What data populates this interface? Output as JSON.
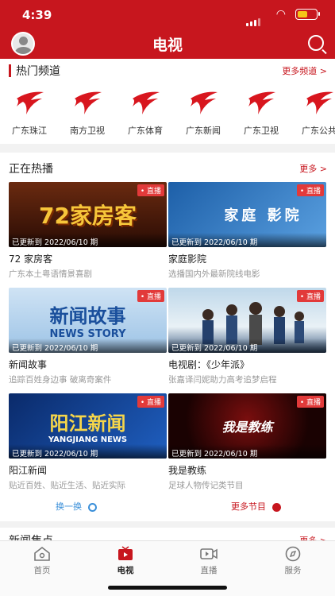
{
  "status_bar": {
    "time": "4:39"
  },
  "header": {
    "title": "电视"
  },
  "hot_channels": {
    "title": "热门频道",
    "more": "更多频道 >",
    "items": [
      "广东珠江",
      "南方卫视",
      "广东体育",
      "广东新闻",
      "广东卫视",
      "广东公共"
    ]
  },
  "now_playing": {
    "title": "正在热播",
    "more": "更多 >",
    "cards": [
      {
        "badge": "• 直播",
        "updated": "已更新到 2022/06/10 期",
        "art": "72家房客",
        "title": "72 家房客",
        "subtitle": "广东本土粤语情景喜剧"
      },
      {
        "badge": "• 直播",
        "updated": "已更新到 2022/06/10 期",
        "art": "家庭 影院",
        "title": "家庭影院",
        "subtitle": "选播国内外最新院线电影"
      },
      {
        "badge": "• 直播",
        "updated": "已更新到 2022/06/10 期",
        "art": "新闻故事",
        "art2": "NEWS STORY",
        "title": "新闻故事",
        "subtitle": "追踪百姓身边事 破离奇案件"
      },
      {
        "badge": "• 直播",
        "updated": "已更新到 2022/06/10 期",
        "art": "",
        "title": "电视剧：《少年派》",
        "subtitle": "张嘉译闫妮助力高考追梦启程"
      },
      {
        "badge": "• 直播",
        "updated": "已更新到 2022/06/10 期",
        "art": "阳江新闻",
        "art2": "YANGJIANG NEWS",
        "title": "阳江新闻",
        "subtitle": "贴近百姓、贴近生活、贴近实际"
      },
      {
        "badge": "• 直播",
        "updated": "已更新到 2022/06/10 期",
        "art": "我是教练",
        "title": "我是教练",
        "subtitle": "足球人物传记类节目"
      }
    ],
    "refresh": "换一换",
    "more_programs": "更多节目"
  },
  "news_focus": {
    "title": "新闻焦点",
    "more": "更多 >"
  },
  "tabbar": {
    "items": [
      "首页",
      "电视",
      "直播",
      "服务"
    ],
    "active": "电视"
  },
  "colors": {
    "brand": "#c7161e",
    "accent_blue": "#3a8fd9"
  }
}
